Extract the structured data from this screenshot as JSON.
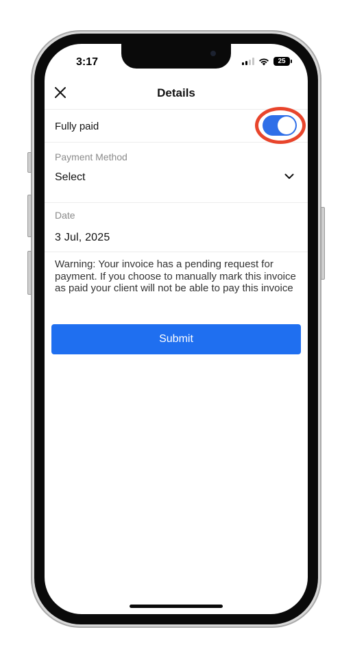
{
  "status_bar": {
    "time": "3:17",
    "battery_level": "25",
    "signal_icon": "cellular-signal-icon",
    "wifi_icon": "wifi-icon"
  },
  "header": {
    "title": "Details",
    "close_icon": "close-icon"
  },
  "fully_paid": {
    "label": "Fully paid",
    "toggle_on": true,
    "accent_color": "#2f6fe8",
    "highlight_color": "#e8452c"
  },
  "payment_method": {
    "caption": "Payment Method",
    "value": "Select",
    "icon": "chevron-down-icon"
  },
  "date": {
    "caption": "Date",
    "value": "3 Jul, 2025"
  },
  "warning": {
    "text": "Warning: Your invoice has a pending request for payment. If you choose to manually mark this invoice as paid your client will not be able to pay this invoice"
  },
  "submit": {
    "label": "Submit",
    "color": "#1f6ff0"
  }
}
